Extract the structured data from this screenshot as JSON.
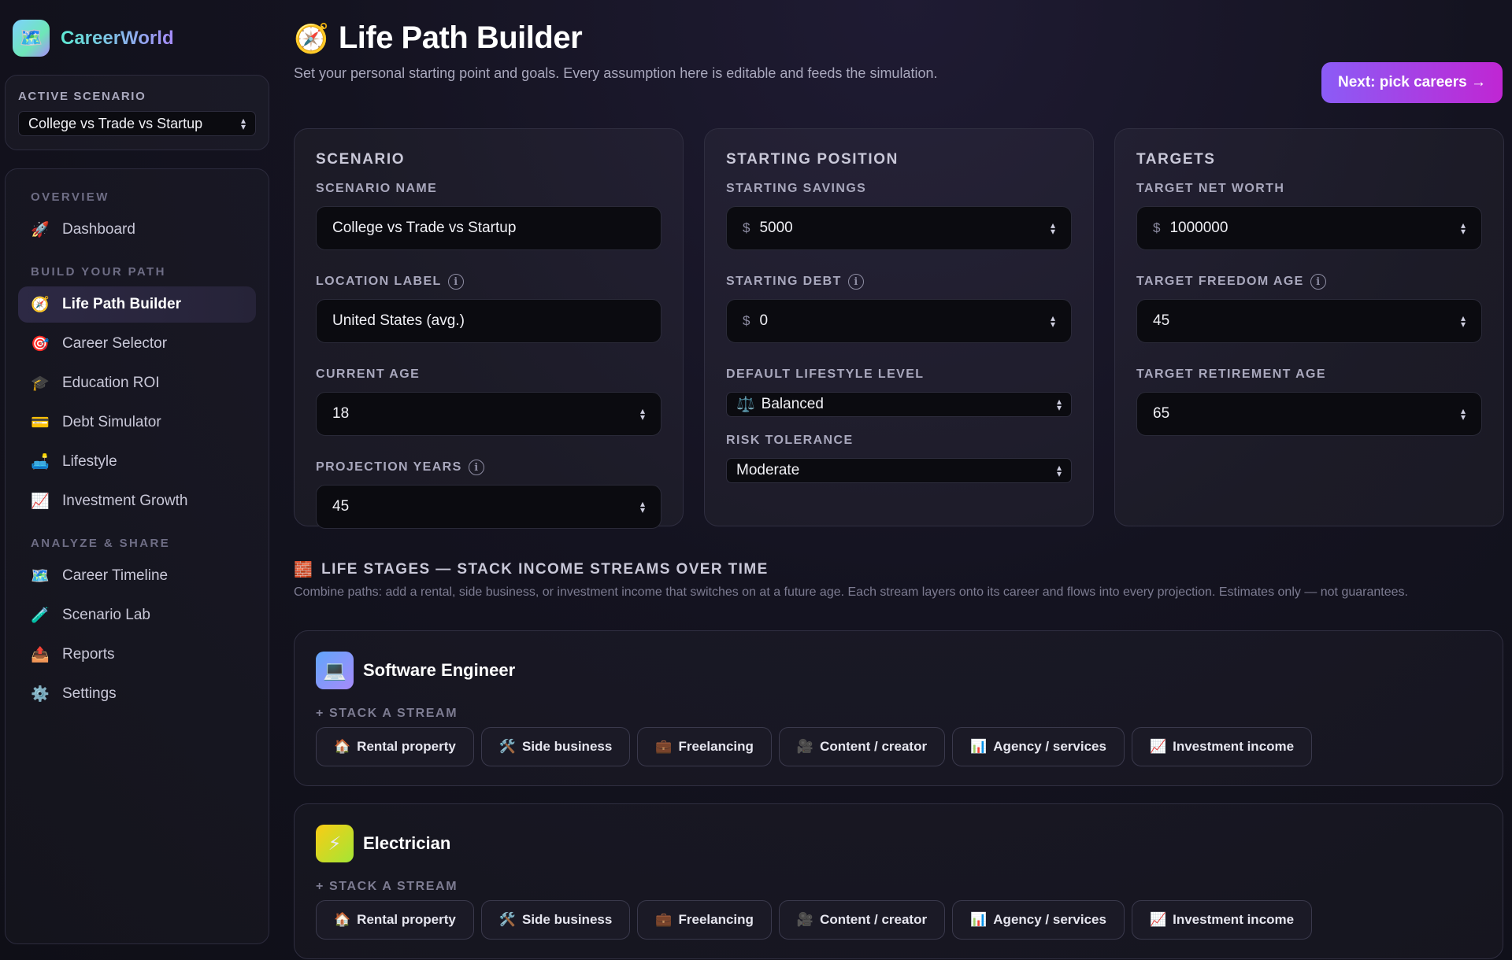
{
  "brand": {
    "name": "CareerWorld",
    "logo_icon": "🗺️"
  },
  "active_scenario": {
    "label": "ACTIVE SCENARIO",
    "value": "College vs Trade vs Startup"
  },
  "nav": {
    "overview_label": "OVERVIEW",
    "dashboard": {
      "icon": "🚀",
      "label": "Dashboard"
    },
    "build_label": "BUILD YOUR PATH",
    "build_items": [
      {
        "icon": "🧭",
        "label": "Life Path Builder"
      },
      {
        "icon": "🎯",
        "label": "Career Selector"
      },
      {
        "icon": "🎓",
        "label": "Education ROI"
      },
      {
        "icon": "💳",
        "label": "Debt Simulator"
      },
      {
        "icon": "🛋️",
        "label": "Lifestyle"
      },
      {
        "icon": "📈",
        "label": "Investment Growth"
      }
    ],
    "analyze_label": "ANALYZE & SHARE",
    "analyze_items": [
      {
        "icon": "🗺️",
        "label": "Career Timeline"
      },
      {
        "icon": "🧪",
        "label": "Scenario Lab"
      },
      {
        "icon": "📤",
        "label": "Reports"
      },
      {
        "icon": "⚙️",
        "label": "Settings"
      }
    ]
  },
  "header": {
    "icon": "🧭",
    "title": "Life Path Builder",
    "subtitle": "Set your personal starting point and goals. Every assumption here is editable and feeds the simulation.",
    "next_button": "Next: pick careers →"
  },
  "scenario_card": {
    "title": "SCENARIO",
    "name_label": "SCENARIO NAME",
    "name_value": "College vs Trade vs Startup",
    "location_label": "LOCATION LABEL",
    "location_value": "United States (avg.)",
    "age_label": "CURRENT AGE",
    "age_value": "18",
    "years_label": "PROJECTION YEARS",
    "years_value": "45"
  },
  "starting_card": {
    "title": "STARTING POSITION",
    "savings_label": "STARTING SAVINGS",
    "savings_value": "5000",
    "debt_label": "STARTING DEBT",
    "debt_value": "0",
    "lifestyle_label": "DEFAULT LIFESTYLE LEVEL",
    "lifestyle_icon": "⚖️",
    "lifestyle_value": "Balanced",
    "risk_label": "RISK TOLERANCE",
    "risk_value": "Moderate",
    "currency": "$"
  },
  "targets_card": {
    "title": "TARGETS",
    "networth_label": "TARGET NET WORTH",
    "networth_value": "1000000",
    "freedom_label": "TARGET FREEDOM AGE",
    "freedom_value": "45",
    "retire_label": "TARGET RETIREMENT AGE",
    "retire_value": "65",
    "currency": "$"
  },
  "life_stages": {
    "icon": "🧱",
    "title": "LIFE STAGES — STACK INCOME STREAMS OVER TIME",
    "subtitle": "Combine paths: add a rental, side business, or investment income that switches on at a future age. Each stream layers onto its career and flows into every projection. Estimates only — not guarantees."
  },
  "streams": [
    {
      "icon": "🏠",
      "label": "Rental property"
    },
    {
      "icon": "🛠️",
      "label": "Side business"
    },
    {
      "icon": "💼",
      "label": "Freelancing"
    },
    {
      "icon": "🎥",
      "label": "Content / creator"
    },
    {
      "icon": "📊",
      "label": "Agency / services"
    },
    {
      "icon": "📈",
      "label": "Investment income"
    }
  ],
  "careers": [
    {
      "icon": "💻",
      "name": "Software Engineer",
      "stack_label": "+ STACK A STREAM"
    },
    {
      "icon": "⚡",
      "name": "Electrician",
      "stack_label": "+ STACK A STREAM"
    }
  ],
  "colors": {
    "accent_start": "#8b5cf6",
    "accent_end": "#c026d3",
    "background": "#141320"
  }
}
